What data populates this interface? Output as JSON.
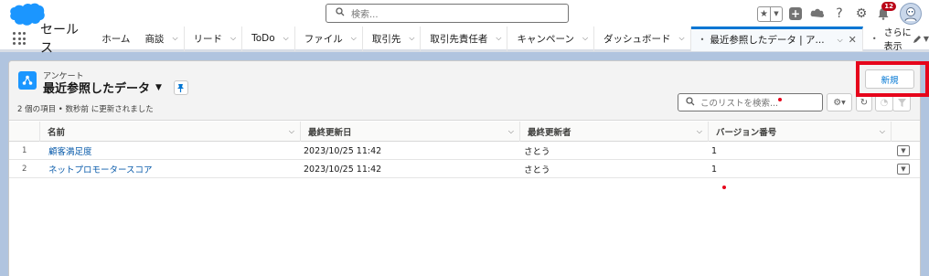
{
  "header": {
    "search_placeholder": "検索...",
    "notification_count": "12"
  },
  "nav": {
    "app_name": "セールス",
    "items": [
      {
        "label": "ホーム"
      },
      {
        "label": "商談"
      },
      {
        "label": "リード"
      },
      {
        "label": "ToDo"
      },
      {
        "label": "ファイル"
      },
      {
        "label": "取引先"
      },
      {
        "label": "取引先責任者"
      },
      {
        "label": "キャンペーン"
      },
      {
        "label": "ダッシュボード"
      }
    ],
    "active_tab": "最近参照したデータ | ア...",
    "more_label": "さらに表示"
  },
  "list": {
    "object_label": "アンケート",
    "title": "最近参照したデータ",
    "status": "2 個の項目 • 数秒前 に更新されました",
    "new_button": "新規",
    "search_placeholder": "このリストを検索..."
  },
  "table": {
    "columns": [
      "名前",
      "最終更新日",
      "最終更新者",
      "バージョン番号"
    ],
    "rows": [
      {
        "num": "1",
        "name": "顧客満足度",
        "date": "2023/10/25 11:42",
        "by": "さとう",
        "version": "1"
      },
      {
        "num": "2",
        "name": "ネットプロモータースコア",
        "date": "2023/10/25 11:42",
        "by": "さとう",
        "version": "1"
      }
    ]
  },
  "colors": {
    "brand_blue": "#0176d3",
    "highlight_red": "#e6051b",
    "background": "#b0c4df"
  }
}
